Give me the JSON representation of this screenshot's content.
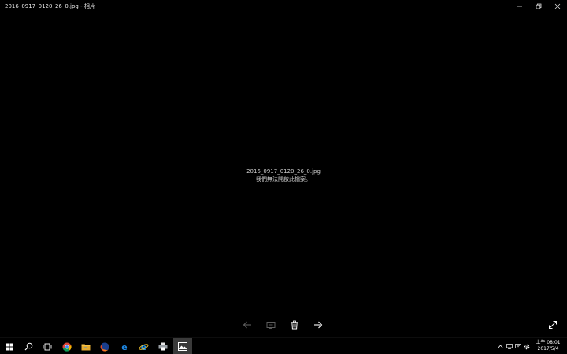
{
  "window": {
    "title": "2016_0917_0120_26_0.jpg - 相片",
    "controls": [
      "minimize-icon",
      "restore-icon",
      "close-icon"
    ]
  },
  "viewer": {
    "file_name": "2016_0917_0120_26_0.jpg",
    "error_message": "我們無法開啟此檔案。",
    "toolbar_icons": [
      "arrow-left-icon",
      "slideshow-icon",
      "trash-icon",
      "arrow-right-icon"
    ],
    "fullscreen_icon": "expand-icon"
  },
  "taskbar": {
    "apps": [
      {
        "name": "start-icon",
        "running": false
      },
      {
        "name": "search-icon",
        "running": false
      },
      {
        "name": "task-view-icon",
        "running": false
      },
      {
        "name": "chrome-icon",
        "running": false
      },
      {
        "name": "file-explorer-icon",
        "running": true
      },
      {
        "name": "firefox-icon",
        "running": false
      },
      {
        "name": "edge-icon",
        "running": false
      },
      {
        "name": "internet-explorer-icon",
        "running": true
      },
      {
        "name": "printer-icon",
        "running": true
      },
      {
        "name": "photos-icon",
        "running": true,
        "active": true
      }
    ],
    "tray_icons": [
      "chevron-up-icon",
      "network-icon",
      "notification-icon",
      "settings-icon"
    ],
    "clock": {
      "time": "上午 08:01",
      "date": "2017/5/4"
    }
  },
  "colors": {
    "background": "#000000",
    "icon_gray": "#6f6f6f",
    "icon_white": "#ffffff",
    "chrome_red": "#db4437",
    "chrome_green": "#0f9d58",
    "chrome_yellow": "#f4b400",
    "chrome_blue": "#4285f4",
    "edge_blue": "#1e88e5",
    "folder_yellow": "#f6c244"
  }
}
